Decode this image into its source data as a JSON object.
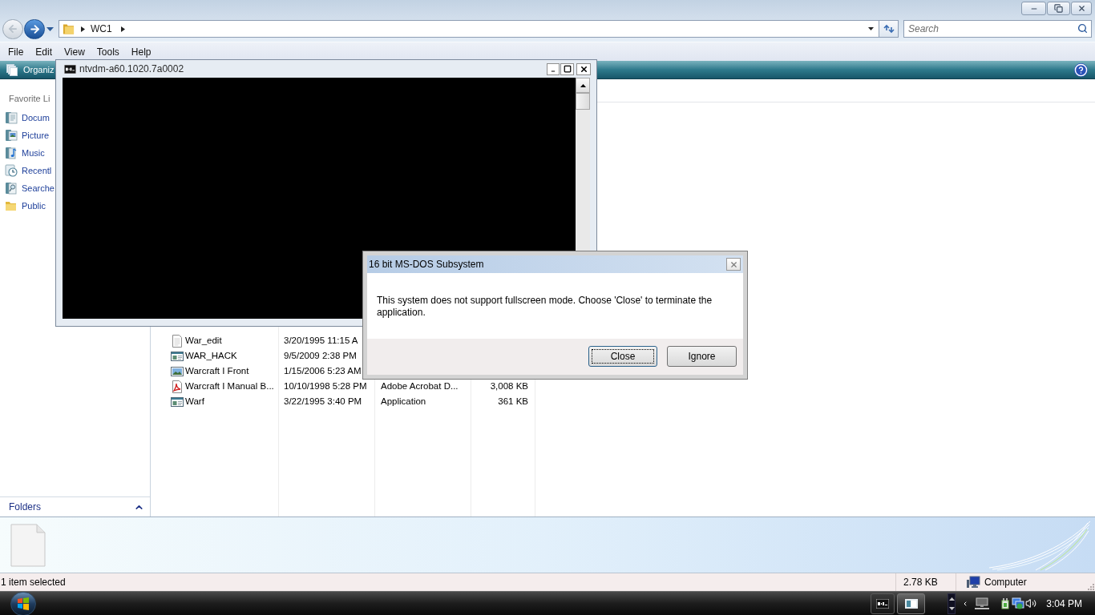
{
  "explorer": {
    "address_bar": {
      "crumbs": [
        "WC1"
      ]
    },
    "search": {
      "placeholder": "Search"
    },
    "menu": [
      "File",
      "Edit",
      "View",
      "Tools",
      "Help"
    ],
    "toolbar": {
      "organize": "Organiz"
    },
    "navigation": {
      "heading": "Favorite Li",
      "links": [
        {
          "label": "Docum",
          "kind": "documents"
        },
        {
          "label": "Picture",
          "kind": "pictures"
        },
        {
          "label": "Music",
          "kind": "music"
        },
        {
          "label": "Recentl",
          "kind": "recent"
        },
        {
          "label": "Searche",
          "kind": "searches"
        },
        {
          "label": "Public",
          "kind": "public"
        }
      ],
      "folders": "Folders"
    },
    "files": [
      {
        "kind": "text",
        "column_1": "War_edit",
        "column_2": "3/20/1995 11:15 A"
      },
      {
        "kind": "app",
        "column_1": "WAR_HACK",
        "column_2": "9/5/2009 2:38 PM"
      },
      {
        "kind": "image",
        "column_1": "Warcraft I Front",
        "column_2": "1/15/2006 5:23 AM"
      },
      {
        "kind": "pdf",
        "column_1": "Warcraft I Manual B...",
        "column_2": "10/10/1998 5:28 PM",
        "column_3": "Adobe Acrobat D...",
        "column_4": "3,008 KB"
      },
      {
        "kind": "app",
        "column_1": "Warf",
        "column_2": "3/22/1995 3:40 PM",
        "column_3": "Application",
        "column_4": "361 KB"
      }
    ],
    "status_bar": {
      "selection": "1 item selected",
      "size": "2.78 KB",
      "zone": "Computer"
    }
  },
  "console_window": {
    "title": "ntvdm-a60.1020.7a0002"
  },
  "dialog": {
    "title": "16 bit MS-DOS Subsystem",
    "message": "This system does not support fullscreen mode. Choose 'Close' to terminate the application.",
    "buttons": [
      {
        "label": "Close",
        "default": true
      },
      {
        "label": "Ignore",
        "default": false
      }
    ]
  },
  "taskbar": {
    "clock": "3:04 PM"
  }
}
